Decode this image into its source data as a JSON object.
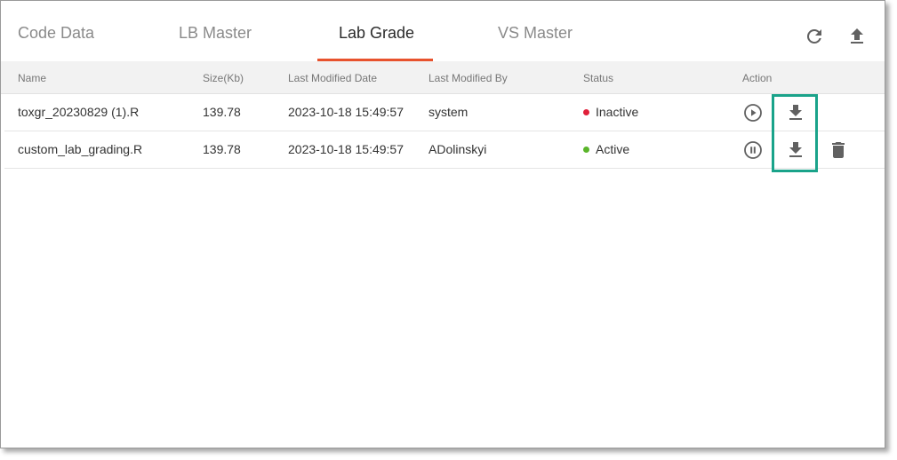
{
  "tabs": [
    {
      "label": "Code Data"
    },
    {
      "label": "LB Master"
    },
    {
      "label": "Lab Grade"
    },
    {
      "label": "VS Master"
    }
  ],
  "toolbar": {
    "refresh_icon": "refresh-icon",
    "upload_icon": "upload-icon"
  },
  "table": {
    "columns": [
      "Name",
      "Size(Kb)",
      "Last Modified Date",
      "Last Modified By",
      "Status",
      "Action"
    ],
    "rows": [
      {
        "name": "toxgr_20230829 (1).R",
        "size": "139.78",
        "modified_date": "2023-10-18 15:49:57",
        "modified_by": "system",
        "status": "Inactive",
        "status_color": "#e0203a",
        "actions": [
          "play-icon",
          "download-icon"
        ]
      },
      {
        "name": "custom_lab_grading.R",
        "size": "139.78",
        "modified_date": "2023-10-18 15:49:57",
        "modified_by": "ADolinskyi",
        "status": "Active",
        "status_color": "#5ab52a",
        "actions": [
          "pause-icon",
          "download-icon",
          "delete-icon"
        ]
      }
    ]
  },
  "colors": {
    "accent": "#e8522d",
    "highlight": "#1aa38a",
    "icon": "#616161"
  }
}
